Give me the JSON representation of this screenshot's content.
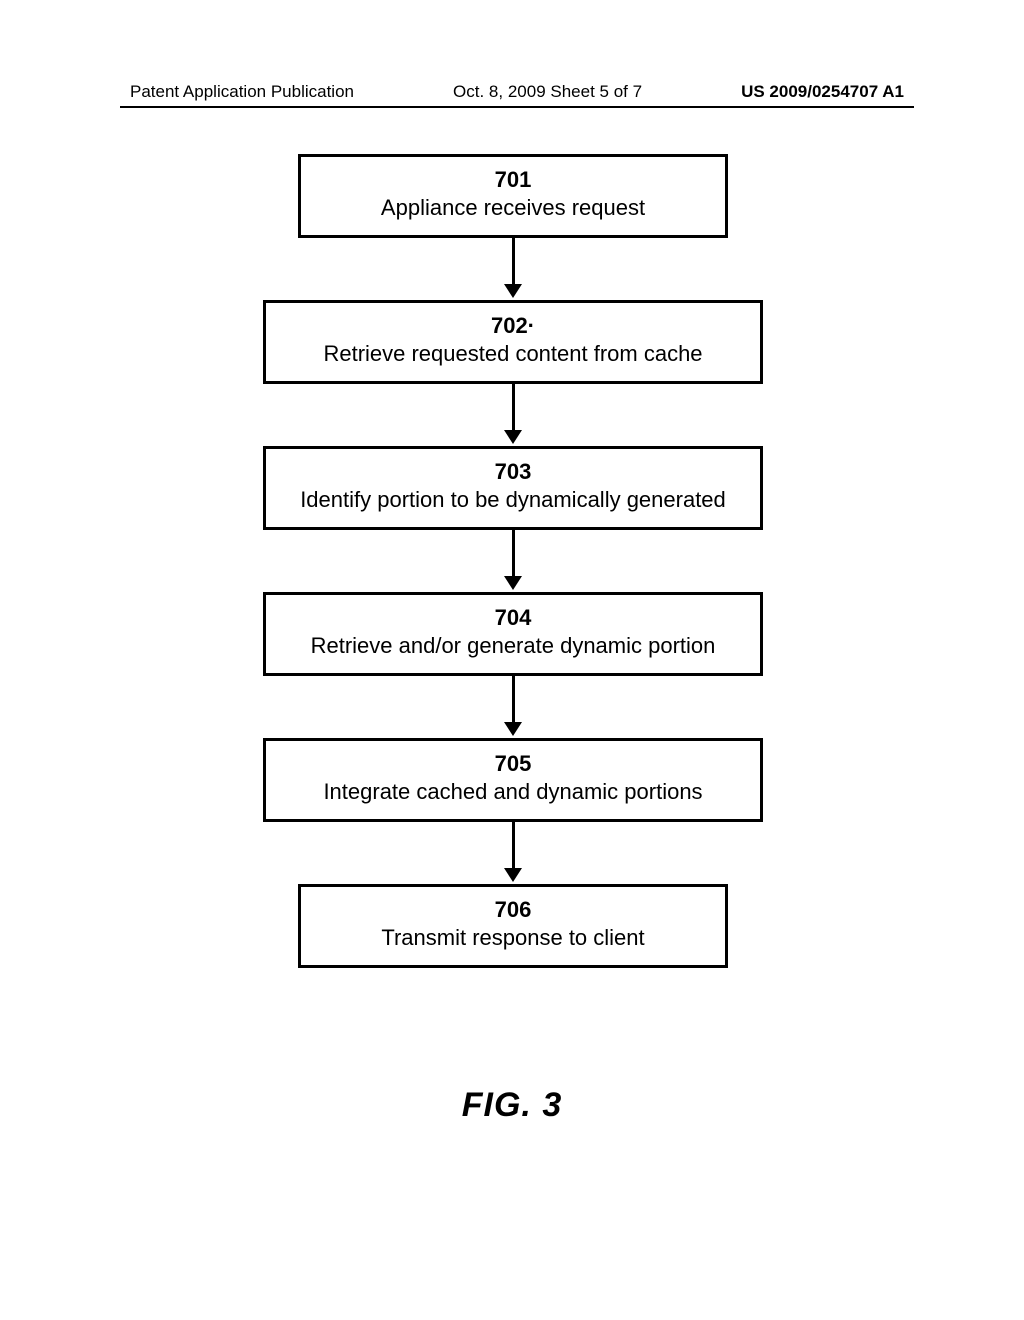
{
  "header": {
    "left": "Patent Application Publication",
    "center": "Oct. 8, 2009  Sheet 5 of 7",
    "right": "US 2009/0254707 A1"
  },
  "boxes": [
    {
      "ref": "701",
      "text": "Appliance receives request"
    },
    {
      "ref": "702·",
      "text": "Retrieve requested content from cache"
    },
    {
      "ref": "703",
      "text": "Identify portion to be dynamically generated"
    },
    {
      "ref": "704",
      "text": "Retrieve and/or generate dynamic portion"
    },
    {
      "ref": "705",
      "text": "Integrate cached and dynamic portions"
    },
    {
      "ref": "706",
      "text": "Transmit response to client"
    }
  ],
  "figure_label": "FIG. 3"
}
